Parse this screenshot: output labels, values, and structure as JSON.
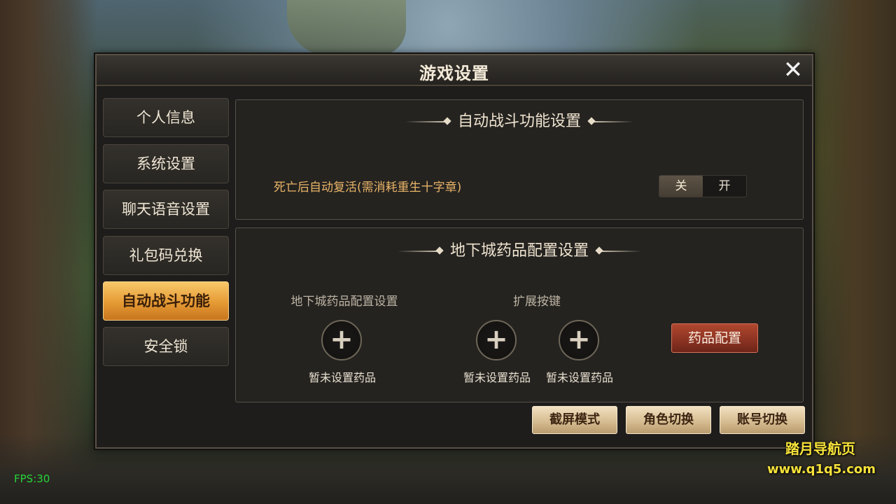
{
  "dialog": {
    "title": "游戏设置",
    "close_icon": "close-icon"
  },
  "tabs": [
    {
      "label": "个人信息",
      "active": false
    },
    {
      "label": "系统设置",
      "active": false
    },
    {
      "label": "聊天语音设置",
      "active": false
    },
    {
      "label": "礼包码兑换",
      "active": false
    },
    {
      "label": "自动战斗功能",
      "active": true
    },
    {
      "label": "安全锁",
      "active": false
    }
  ],
  "auto_battle": {
    "section_title": "自动战斗功能设置",
    "revive_label": "死亡后自动复活(需消耗重生十字章)",
    "toggle_off": "关",
    "toggle_on": "开",
    "toggle_selected": "关"
  },
  "dungeon": {
    "section_title": "地下城药品配置设置",
    "slot_group_label": "地下城药品配置设置",
    "extend_label": "扩展按键",
    "slots": [
      {
        "caption": "暂未设置药品",
        "icon": "plus-icon"
      },
      {
        "caption": "暂未设置药品",
        "icon": "plus-icon"
      },
      {
        "caption": "暂未设置药品",
        "icon": "plus-icon"
      }
    ],
    "config_button": "药品配置"
  },
  "footer_buttons": [
    "截屏模式",
    "角色切换",
    "账号切换"
  ],
  "overlay": {
    "fps": "FPS:30",
    "watermark_title": "踏月导航页",
    "watermark_url": "www.q1q5.com"
  },
  "colors": {
    "accent": "#e59a34",
    "option_text": "#e8b468",
    "danger_button": "#8a3222",
    "fps_text": "#26d43a"
  }
}
